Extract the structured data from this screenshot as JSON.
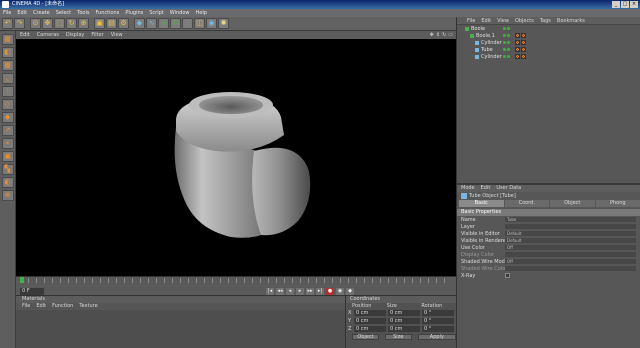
{
  "app": {
    "title": "CINEMA 4D - [未命名]"
  },
  "window_buttons": [
    "_",
    "□",
    "×"
  ],
  "menubar": [
    "File",
    "Edit",
    "Create",
    "Select",
    "Tools",
    "Functions",
    "Plugins",
    "Script",
    "Window",
    "Help"
  ],
  "toolbar": {
    "icons": [
      "undo-icon",
      "redo-icon",
      "select-icon",
      "move-icon",
      "scale-icon",
      "rotate-icon",
      "coordinate-icon",
      "render-icon",
      "cube-icon",
      "spline-icon",
      "nurbs-icon",
      "array-icon",
      "deformer-icon",
      "scene-icon",
      "camera-icon",
      "light-icon"
    ]
  },
  "left_tools": [
    "model-icon",
    "object-icon",
    "texture-icon",
    "axis-icon",
    "points-icon",
    "edges-icon",
    "polygons-icon",
    "tweak-icon",
    "snap-icon",
    "workplane-icon",
    "checker-icon",
    "sculpt-icon",
    "lock-icon"
  ],
  "viewport": {
    "menu": [
      "Edit",
      "Cameras",
      "Display",
      "Filter",
      "View"
    ],
    "bg_color": "#000000"
  },
  "timeline": {
    "current_frame": "0 F"
  },
  "materials": {
    "header": "Materials",
    "menu": [
      "File",
      "Edit",
      "Function",
      "Texture"
    ]
  },
  "coordinates": {
    "header": "Coordinates",
    "columns": [
      "Position",
      "Size",
      "Rotation"
    ],
    "rows": [
      {
        "axis": "X",
        "pos": "0 cm",
        "size": "0 cm",
        "rot": "0 °"
      },
      {
        "axis": "Y",
        "pos": "0 cm",
        "size": "0 cm",
        "rot": "0 °"
      },
      {
        "axis": "Z",
        "pos": "0 cm",
        "size": "0 cm",
        "rot": "0 °"
      }
    ],
    "mode": "Object",
    "size_mode": "Size",
    "apply": "Apply"
  },
  "object_manager": {
    "menu": [
      "File",
      "Edit",
      "View",
      "Objects",
      "Tags",
      "Bookmarks"
    ],
    "objects": [
      {
        "name": "Boole",
        "indent": 0
      },
      {
        "name": "Boole.1",
        "indent": 1
      },
      {
        "name": "Cylinder",
        "indent": 2
      },
      {
        "name": "Tube",
        "indent": 2
      },
      {
        "name": "Cylinder",
        "indent": 2
      }
    ]
  },
  "attribute_manager": {
    "menu": [
      "Mode",
      "Edit",
      "User Data"
    ],
    "title": "Tube Object [Tube]",
    "tabs": [
      "Basic",
      "Coord.",
      "Object",
      "Phong"
    ],
    "section": "Basic Properties",
    "props": [
      {
        "label": "Name",
        "value": "Tube"
      },
      {
        "label": "Layer",
        "value": ""
      },
      {
        "label": "Visible in Editor",
        "value": "Default"
      },
      {
        "label": "Visible in Renderer",
        "value": "Default"
      },
      {
        "label": "Use Color",
        "value": "Off"
      },
      {
        "label": "Display Color",
        "value": "",
        "dim": true
      },
      {
        "label": "Shaded Wire Mode",
        "value": "Off"
      },
      {
        "label": "Shaded Wire Color",
        "value": "",
        "dim": true
      },
      {
        "label": "X-Ray",
        "value": ""
      }
    ]
  }
}
